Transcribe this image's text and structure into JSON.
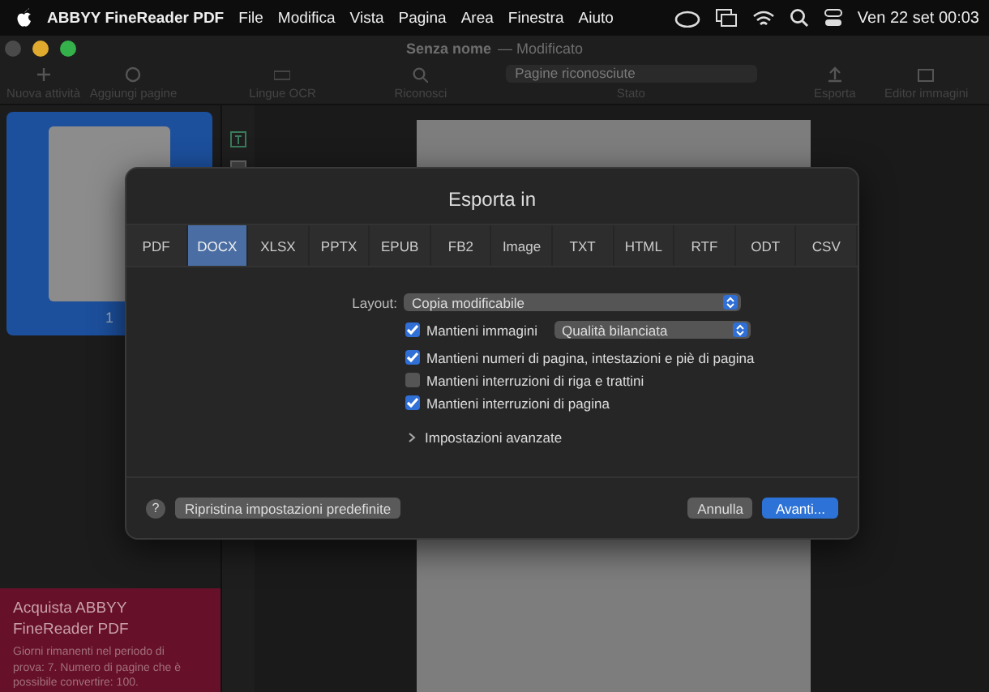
{
  "menu_bar": {
    "app_name": "ABBYY FineReader PDF",
    "items": [
      "File",
      "Modifica",
      "Vista",
      "Pagina",
      "Area",
      "Finestra",
      "Aiuto"
    ],
    "clock": "Ven 22 set  00:03"
  },
  "window": {
    "title": "Senza nome",
    "subtitle": "— Modificato",
    "status_field": "Pagine riconosciute",
    "toolbar": [
      {
        "label": "Nuova attività",
        "kind": "plus"
      },
      {
        "label": "Aggiungi pagine",
        "kind": "add"
      },
      {
        "label": "Lingue OCR",
        "kind": "lang"
      },
      {
        "label": "Riconosci",
        "kind": "search"
      },
      {
        "label": "Stato",
        "kind": "status"
      },
      {
        "label": "Esporta",
        "kind": "export"
      },
      {
        "label": "Editor immagini",
        "kind": "image"
      }
    ]
  },
  "sidebar": {
    "pages": [
      {
        "label": "1",
        "selected": true
      }
    ],
    "promo": {
      "title": "Acquista ABBYY FineReader PDF",
      "text": "Giorni rimanenti nel periodo di prova: 7. Numero di pagine che è possibile convertire: 100."
    }
  },
  "dialog": {
    "title": "Esporta in",
    "tabs": [
      {
        "label": "PDF",
        "selected": false
      },
      {
        "label": "DOCX",
        "selected": true
      },
      {
        "label": "XLSX",
        "selected": false
      },
      {
        "label": "PPTX",
        "selected": false
      },
      {
        "label": "EPUB",
        "selected": false
      },
      {
        "label": "FB2",
        "selected": false
      },
      {
        "label": "Image",
        "selected": false
      },
      {
        "label": "TXT",
        "selected": false
      },
      {
        "label": "HTML",
        "selected": false
      },
      {
        "label": "RTF",
        "selected": false
      },
      {
        "label": "ODT",
        "selected": false
      },
      {
        "label": "CSV",
        "selected": false
      }
    ],
    "layout": {
      "label": "Layout:",
      "value": "Copia modificabile"
    },
    "options": [
      {
        "label": "Mantieni immagini",
        "checked": true,
        "select": "Qualità bilanciata"
      },
      {
        "label": "Mantieni numeri di pagina, intestazioni e piè di pagina",
        "checked": true
      },
      {
        "label": "Mantieni interruzioni di riga e trattini",
        "checked": false
      },
      {
        "label": "Mantieni interruzioni di pagina",
        "checked": true
      }
    ],
    "advanced": {
      "label": "Impostazioni avanzate",
      "expanded": false
    },
    "help": "?",
    "reset": "Ripristina impostazioni predefinite",
    "cancel": "Annulla",
    "ok": "Avanti..."
  }
}
